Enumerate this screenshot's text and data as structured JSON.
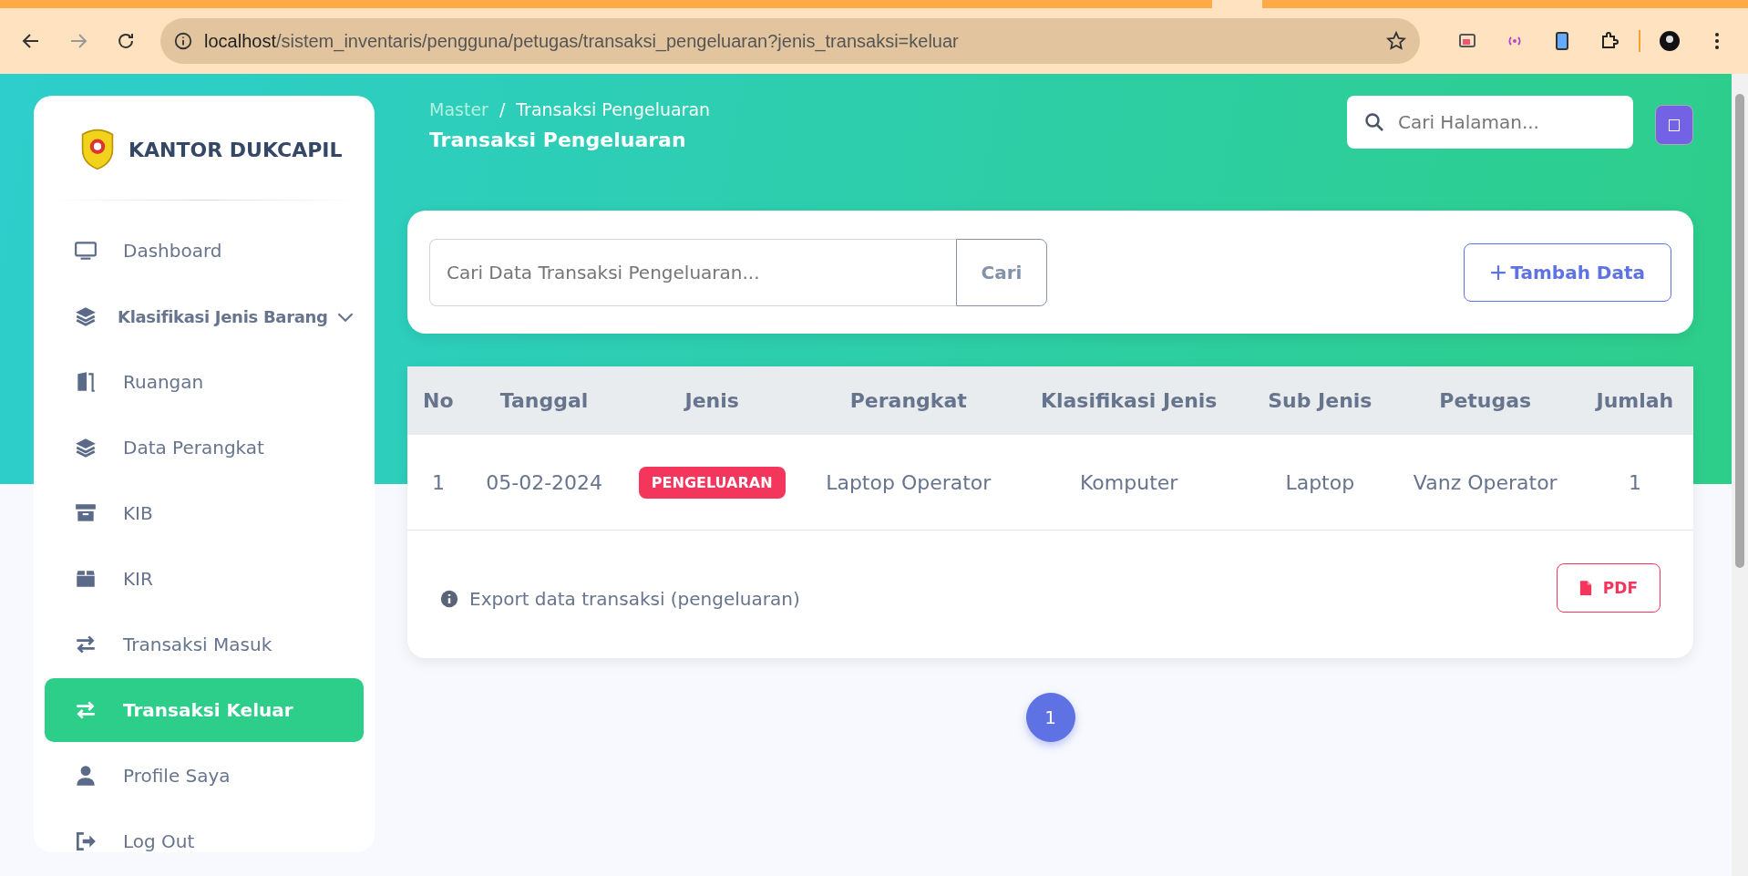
{
  "browser": {
    "url_host": "localhost",
    "url_path": "/sistem_inventaris/pengguna/petugas/transaksi_pengeluaran?jenis_transaksi=keluar"
  },
  "sidebar": {
    "brand": "KANTOR DUKCAPIL",
    "items": [
      {
        "label": "Dashboard",
        "kind": "monitor",
        "selected": false
      },
      {
        "label": "Klasifikasi Jenis Barang",
        "kind": "layers",
        "selected": false,
        "expanded": false
      },
      {
        "label": "Ruangan",
        "kind": "door",
        "selected": false
      },
      {
        "label": "Data Perangkat",
        "kind": "layers",
        "selected": false
      },
      {
        "label": "KIB",
        "kind": "archive",
        "selected": false
      },
      {
        "label": "KIR",
        "kind": "box",
        "selected": false
      },
      {
        "label": "Transaksi Masuk",
        "kind": "swap",
        "selected": false
      },
      {
        "label": "Transaksi Keluar",
        "kind": "swap",
        "selected": true
      },
      {
        "label": "Profile Saya",
        "kind": "user",
        "selected": false
      },
      {
        "label": "Log Out",
        "kind": "logout",
        "selected": false
      }
    ]
  },
  "header": {
    "breadcrumb": [
      "Master",
      "Transaksi Pengeluaran"
    ],
    "breadcrumb_separator": "/",
    "title": "Transaksi Pengeluaran",
    "page_search": {
      "placeholder": "Cari Halaman..."
    }
  },
  "toolbar": {
    "search": {
      "placeholder": "Cari Data Transaksi Pengeluaran..."
    },
    "search_button": "Cari",
    "add_button": "Tambah Data"
  },
  "table": {
    "columns": [
      "No",
      "Tanggal",
      "Jenis",
      "Perangkat",
      "Klasifikasi Jenis",
      "Sub Jenis",
      "Petugas",
      "Jumlah"
    ],
    "rows": [
      {
        "no": "1",
        "tanggal": "05-02-2024",
        "jenis": {
          "label": "PENGELUARAN",
          "kind": "out"
        },
        "perangkat": "Laptop Operator",
        "klasifikasi": "Komputer",
        "sub_jenis": "Laptop",
        "petugas": "Vanz Operator",
        "jumlah": "1"
      }
    ]
  },
  "export": {
    "note": "Export data transaksi (pengeluaran)",
    "button": "PDF"
  },
  "pagination": [
    {
      "label": "1",
      "selected": true
    }
  ]
}
